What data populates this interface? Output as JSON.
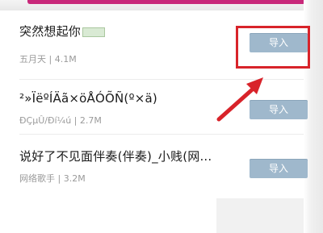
{
  "songs": [
    {
      "title": "突然想起你",
      "meta": "五月天 | 4.1M",
      "action": "导入"
    },
    {
      "title": "²»ÏëºÍÄã×öÅÓÕÑ(º×ä)",
      "meta": "ÐÇµÛ/Ðí¼ú | 2.7M",
      "action": "导入"
    },
    {
      "title": "说好了不见面伴奏(伴奏)_小贱(网...",
      "meta": "网络歌手 | 3.2M",
      "action": "导入"
    }
  ],
  "annotation": {
    "color": "#d8232a",
    "target": "import-button-1"
  },
  "colors": {
    "accent": "#c8287a",
    "import_button": "#9fb8cc"
  }
}
